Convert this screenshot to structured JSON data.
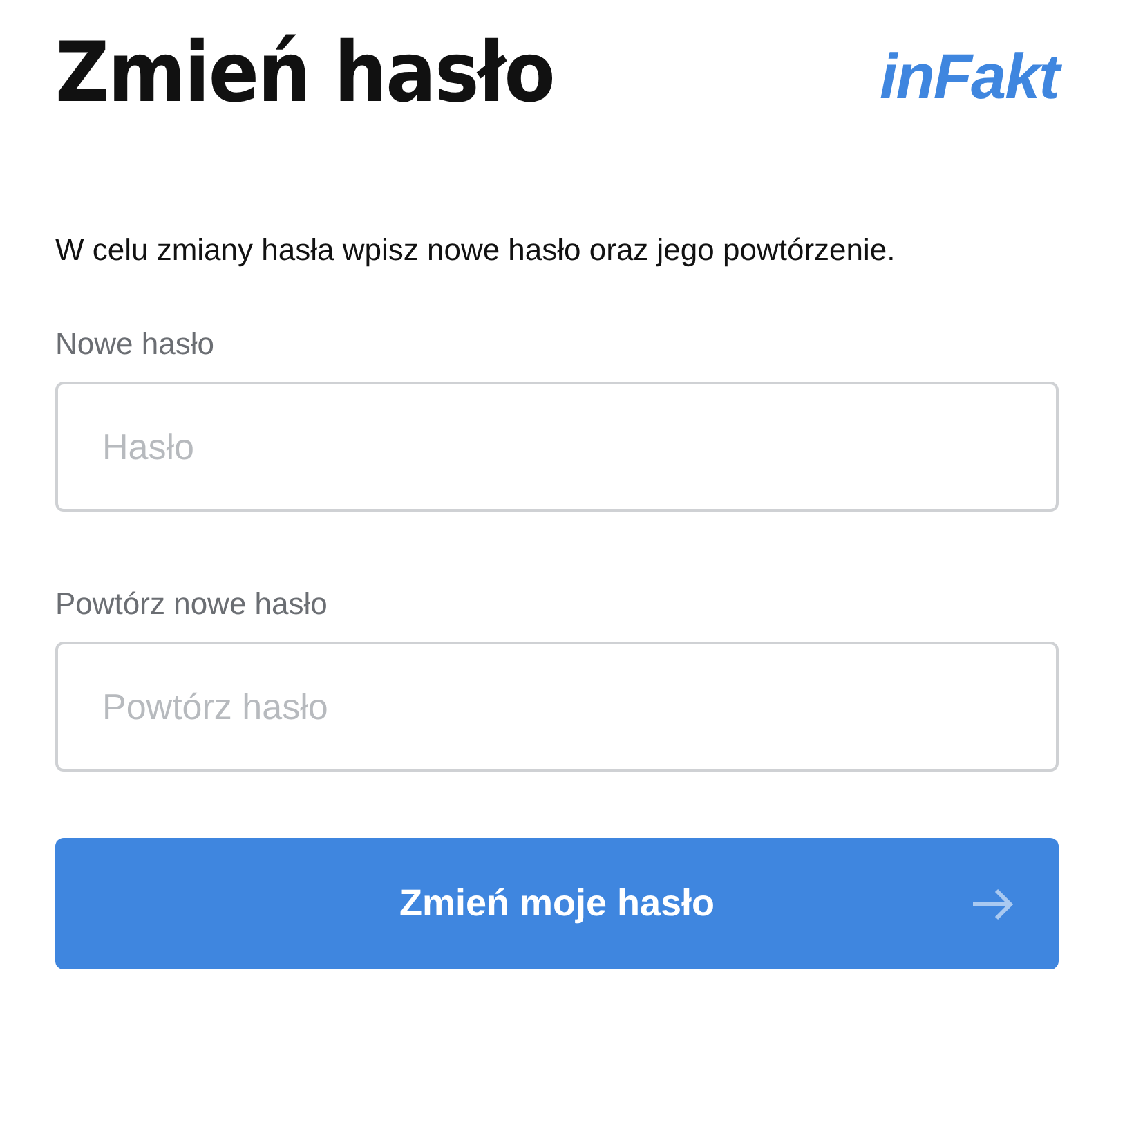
{
  "title": "Zmień hasło",
  "logo": "inFakt",
  "description": "W celu zmiany hasła wpisz nowe hasło oraz jego powtórzenie.",
  "fields": [
    {
      "label": "Nowe hasło",
      "placeholder": "Hasło"
    },
    {
      "label": "Powtórz nowe hasło",
      "placeholder": "Powtórz hasło"
    }
  ],
  "submit": {
    "label": "Zmień moje hasło"
  }
}
